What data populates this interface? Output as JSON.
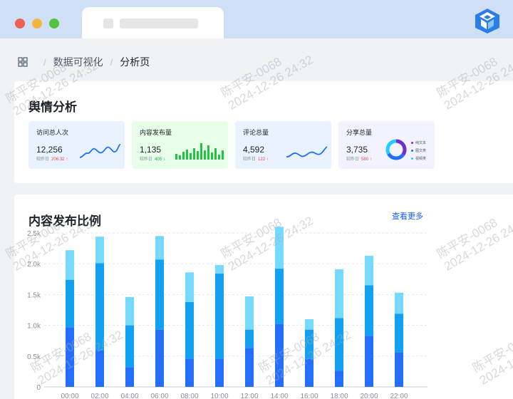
{
  "breadcrumb": {
    "items": [
      "数据可视化",
      "分析页"
    ],
    "separator": "/"
  },
  "overview": {
    "title": "舆情分析",
    "compare_label": "较昨日",
    "cards": [
      {
        "title": "访问总人次",
        "value": "12,256",
        "delta": "206.32",
        "trend": "up",
        "mini": "line",
        "bg": "#e8f3ff"
      },
      {
        "title": "内容发布量",
        "value": "1,135",
        "delta": "405",
        "trend": "down",
        "mini": "bar",
        "bg": "#e8ffea"
      },
      {
        "title": "评论总量",
        "value": "4,592",
        "delta": "122",
        "trend": "up",
        "mini": "line",
        "bg": "#e8f3ff"
      },
      {
        "title": "分享总量",
        "value": "3,735",
        "delta": "580",
        "trend": "up",
        "mini": "pie",
        "bg": "#f2f3ff"
      }
    ],
    "share_legend": [
      "纯文本",
      "图文类",
      "视频类"
    ]
  },
  "chart_section": {
    "title": "内容发布比例",
    "more_link": "查看更多"
  },
  "colors": {
    "series": [
      "#246efd",
      "#11a1f0",
      "#76dafe"
    ],
    "up": "#f53f3f",
    "down": "#00b42a",
    "accent": "#165dff"
  },
  "watermark": {
    "lines": [
      "陈平安-0068",
      "2024-12-26 24:32"
    ]
  },
  "chart_data": {
    "type": "bar",
    "stacked": true,
    "categories": [
      "00:00",
      "02:00",
      "04:00",
      "06:00",
      "08:00",
      "10:00",
      "12:00",
      "14:00",
      "16:00",
      "18:00",
      "20:00",
      "22:00"
    ],
    "series": [
      {
        "values": [
          970,
          590,
          320,
          930,
          460,
          460,
          630,
          1020,
          460,
          260,
          830,
          560
        ]
      },
      {
        "values": [
          770,
          1420,
          680,
          1140,
          920,
          1380,
          300,
          900,
          470,
          860,
          820,
          630
        ]
      },
      {
        "values": [
          480,
          430,
          460,
          380,
          480,
          140,
          540,
          680,
          170,
          790,
          480,
          340
        ]
      }
    ],
    "yticks": [
      "0",
      "0.5k",
      "1.0k",
      "1.5k",
      "2.0k",
      "2.5k"
    ],
    "ylim": [
      0,
      2600
    ],
    "grid": true
  }
}
